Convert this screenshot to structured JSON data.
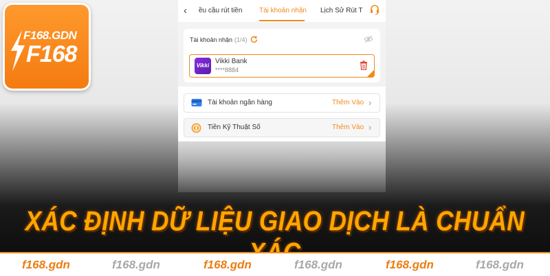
{
  "logo": {
    "small_text": "F168.GDN",
    "big_text": "F168"
  },
  "topnav": {
    "tabs": [
      {
        "label": "ều cầu rút tiền"
      },
      {
        "label": "Tài khoản nhận"
      },
      {
        "label": "Lịch Sử Rút T"
      }
    ],
    "active_tab": "Tài khoản nhận"
  },
  "accounts": {
    "title": "Tài khoản nhận",
    "count": "(1/4)",
    "bank": {
      "logo_text": "Vikki",
      "name": "Vikki Bank",
      "number": "****8884"
    }
  },
  "methods": [
    {
      "label": "Tài khoản ngân hàng",
      "action": "Thêm Vào"
    },
    {
      "label": "Tiền Kỹ Thuật Số",
      "action": "Thêm Vào"
    }
  ],
  "headline": "XÁC ĐỊNH DỮ LIỆU GIAO DỊCH LÀ CHUẨN XÁC",
  "watermarks": [
    "f168.gdn",
    "f168.gdn",
    "f168.gdn",
    "f168.gdn",
    "f168.gdn",
    "f168.gdn"
  ],
  "colors": {
    "accent": "#f08a1b",
    "headline": "#ffa600"
  }
}
